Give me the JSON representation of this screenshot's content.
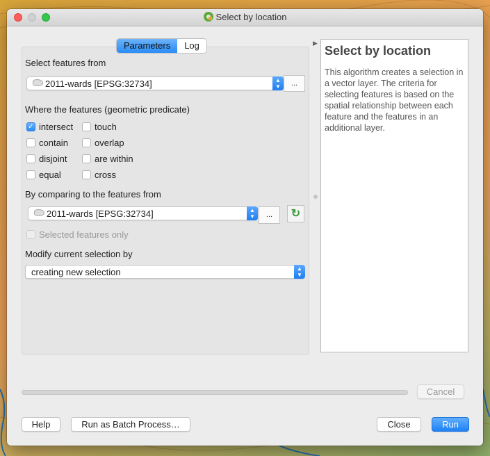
{
  "window": {
    "title": "Select by location"
  },
  "tabs": [
    {
      "label": "Parameters",
      "active": true
    },
    {
      "label": "Log",
      "active": false
    }
  ],
  "params": {
    "select_from_label": "Select features from",
    "select_from_value": "2011-wards [EPSG:32734]",
    "predicate_label": "Where the features (geometric predicate)",
    "predicates": [
      {
        "label": "intersect",
        "checked": true
      },
      {
        "label": "touch",
        "checked": false
      },
      {
        "label": "contain",
        "checked": false
      },
      {
        "label": "overlap",
        "checked": false
      },
      {
        "label": "disjoint",
        "checked": false
      },
      {
        "label": "are within",
        "checked": false
      },
      {
        "label": "equal",
        "checked": false
      },
      {
        "label": "cross",
        "checked": false
      }
    ],
    "compare_label": "By comparing to the features from",
    "compare_value": "2011-wards [EPSG:32734]",
    "selected_only_label": "Selected features only",
    "modify_label": "Modify current selection by",
    "modify_value": "creating new selection",
    "ellipsis": "..."
  },
  "help": {
    "title": "Select by location",
    "body": "This algorithm creates a selection in a vector layer. The criteria for selecting features is based on the spatial relationship between each feature and the features in an additional layer."
  },
  "progress": {
    "value": 0
  },
  "buttons": {
    "cancel": "Cancel",
    "help": "Help",
    "batch": "Run as Batch Process…",
    "close": "Close",
    "run": "Run"
  }
}
